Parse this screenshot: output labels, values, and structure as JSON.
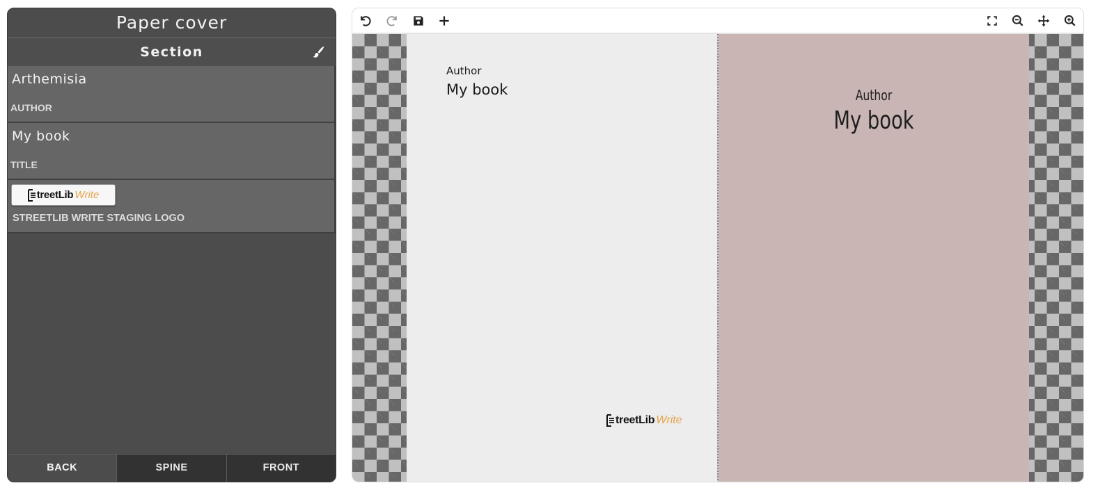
{
  "panel": {
    "title": "Paper cover",
    "section": "Section",
    "fields": [
      {
        "value": "Arthemisia",
        "label": "AUTHOR"
      },
      {
        "value": "My book",
        "label": "TITLE"
      }
    ],
    "logo_field": {
      "brand_main": "treetLib",
      "brand_accent": "Write",
      "label": "STREETLIB WRITE STAGING LOGO"
    },
    "tabs": [
      {
        "label": "BACK",
        "active": true
      },
      {
        "label": "SPINE",
        "active": false
      },
      {
        "label": "FRONT",
        "active": false
      }
    ]
  },
  "toolbar": {
    "left_icons": [
      "undo-icon",
      "redo-icon",
      "save-icon",
      "add-icon"
    ],
    "right_icons": [
      "fullscreen-icon",
      "zoom-out-icon",
      "move-icon",
      "zoom-in-icon"
    ]
  },
  "canvas": {
    "back": {
      "author": "Author",
      "title": "My book",
      "brand_main": "treetLib",
      "brand_accent": "Write",
      "background": "#ededed"
    },
    "front": {
      "author": "Author",
      "title": "My book",
      "background": "#c9b6b4"
    }
  },
  "colors": {
    "accent": "#e5a24a",
    "panel": "#4c4c4c",
    "field": "#666666"
  }
}
